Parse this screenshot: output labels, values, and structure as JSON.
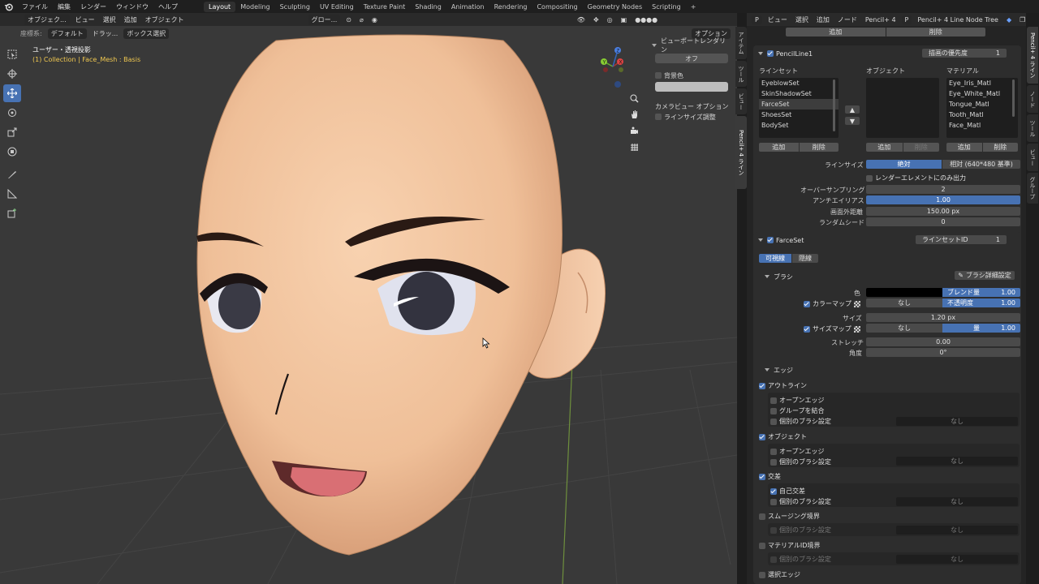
{
  "topbar": {
    "menu": [
      "ファイル",
      "編集",
      "レンダー",
      "ウィンドウ",
      "ヘルプ"
    ],
    "workspaces": [
      "Layout",
      "Modeling",
      "Sculpting",
      "UV Editing",
      "Texture Paint",
      "Shading",
      "Animation",
      "Rendering",
      "Compositing",
      "Geometry Nodes",
      "Scripting"
    ],
    "active_workspace": "Layout",
    "add_tab": "+"
  },
  "viewport": {
    "header": {
      "mode": "オブジェク...",
      "view": "ビュー",
      "select": "選択",
      "add": "追加",
      "object": "オブジェクト",
      "transform": "グロー...",
      "options": "オプション"
    },
    "sub": {
      "coord_label": "座標系:",
      "coord_value": "デフォルト",
      "drag_label": "ドラッ...",
      "box_select": "ボックス選択"
    },
    "info_line1": "ユーザー・透視投影",
    "info_line2": "(1) Collection | Face_Mesh : Basis",
    "gizmo": {
      "x": "X",
      "y": "Y",
      "z": "Z"
    },
    "npanel": {
      "title": "ビューポートレンダリン",
      "off_button": "オフ",
      "background_color": "背景色",
      "camera_title": "カメラビュー オプション",
      "line_size_adjust": "ラインサイズ調整"
    },
    "vtabs": [
      "アイテム",
      "ツール",
      "ビュー",
      "Pencil+ 4 ライン"
    ]
  },
  "properties": {
    "header": {
      "view": "ビュー",
      "select": "選択",
      "add": "追加",
      "node": "ノード",
      "node_name": "Pencil+ 4",
      "tree_name": "Pencil+ 4 Line Node Tree"
    },
    "top_add": "追加",
    "top_delete": "削除",
    "pencil_line": {
      "name": "PencilLine1",
      "priority_label": "描画の優先度",
      "priority_value": "1",
      "lineset_label": "ラインセット",
      "object_label": "オブジェクト",
      "material_label": "マテリアル",
      "linesets": [
        "EyeblowSet",
        "SkinShadowSet",
        "FarceSet",
        "ShoesSet",
        "BodySet"
      ],
      "selected_lineset": "FarceSet",
      "materials": [
        "Eye_Iris_Matl",
        "Eye_White_Matl",
        "Tongue_Matl",
        "Tooth_Matl",
        "Face_Matl"
      ],
      "add": "追加",
      "delete": "削除",
      "line_size_label": "ラインサイズ",
      "line_size_abs": "絶対",
      "line_size_rel": "相対 (640*480 基準)",
      "render_only": "レンダーエレメントにのみ出力",
      "oversampling_label": "オーバーサンプリング",
      "oversampling_value": "2",
      "antialias_label": "アンチエイリアス",
      "antialias_value": "1.00",
      "offscreen_label": "画面外距離",
      "offscreen_value": "150.00 px",
      "seed_label": "ランダムシード",
      "seed_value": "0"
    },
    "lineset": {
      "name": "FarceSet",
      "id_label": "ラインセットID",
      "id_value": "1",
      "tab_visible": "可視線",
      "tab_hidden": "隠線",
      "brush_section": "ブラシ",
      "brush_detail": "ブラシ詳細設定",
      "color_label": "色",
      "blend_label": "ブレンド量",
      "blend_value": "1.00",
      "colormap_label": "カラーマップ",
      "none": "なし",
      "opacity_label": "不透明度",
      "opacity_value": "1.00",
      "size_label": "サイズ",
      "size_value": "1.20 px",
      "sizemap_label": "サイズマップ",
      "amount_label": "量",
      "amount_value": "1.00",
      "stretch_label": "ストレッチ",
      "stretch_value": "0.00",
      "angle_label": "角度",
      "angle_value": "0°",
      "edge_section": "エッジ",
      "outline": "アウトライン",
      "open_edge": "オープンエッジ",
      "merge_groups": "グループを結合",
      "individual_brush": "個別のブラシ設定",
      "object": "オブジェクト",
      "intersection": "交差",
      "self_intersection": "自己交差",
      "smoothing": "スムージング境界",
      "material_id": "マテリアルID境界",
      "selected_edge": "選択エッジ"
    },
    "vtabs": [
      "Pencil+ 4 ライン",
      "ノード",
      "ツール",
      "ビュー",
      "グループ"
    ]
  },
  "colors": {
    "accent": "#4772b3",
    "skin": "#f2c4a0",
    "viewport_bg": "#393939"
  }
}
